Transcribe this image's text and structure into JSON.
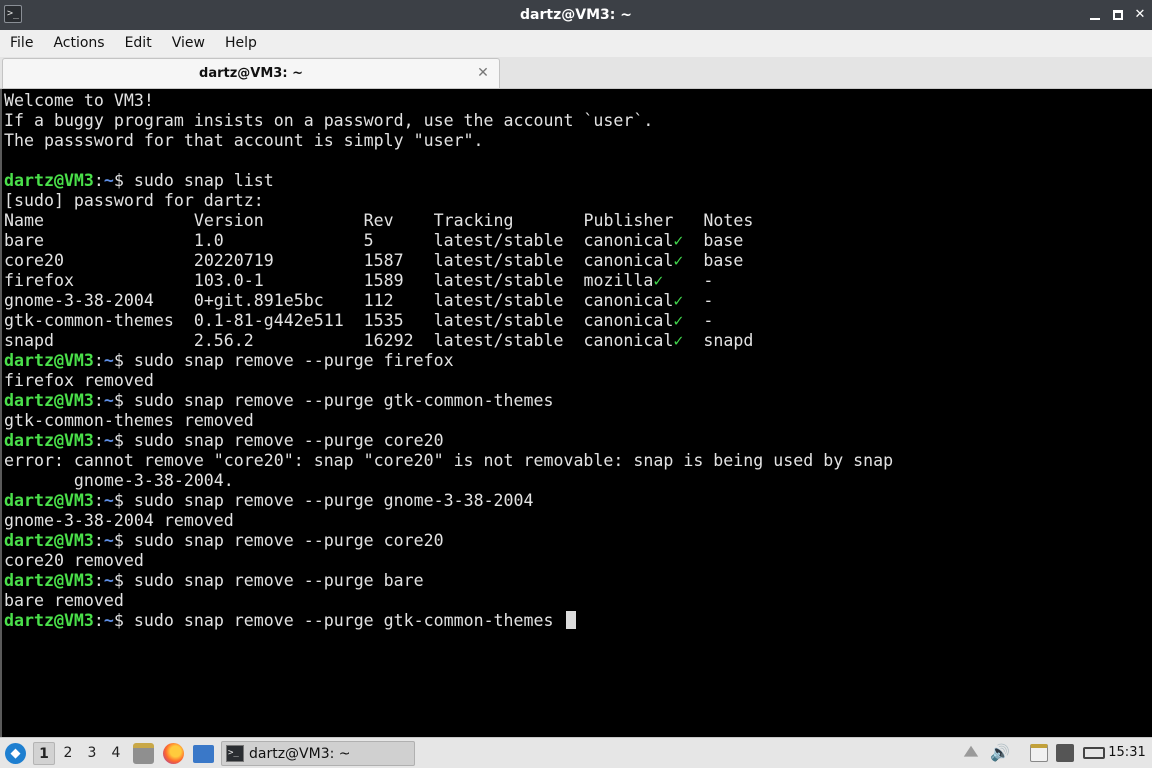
{
  "window": {
    "title": "dartz@VM3: ~",
    "icon_glyph": ">_",
    "close_glyph": "✕"
  },
  "menu": [
    "File",
    "Actions",
    "Edit",
    "View",
    "Help"
  ],
  "tab": {
    "label": "dartz@VM3: ~",
    "close_glyph": "✕"
  },
  "terminal": {
    "prompt_user": "dartz@VM3",
    "prompt_sep": ":",
    "prompt_path": "~",
    "prompt_dollar": "$ ",
    "lines": [
      {
        "kind": "out",
        "text": "Welcome to VM3!"
      },
      {
        "kind": "out",
        "text": "If a buggy program insists on a password, use the account `user`."
      },
      {
        "kind": "out",
        "text": "The passsword for that account is simply \"user\"."
      },
      {
        "kind": "out",
        "text": ""
      },
      {
        "kind": "cmd",
        "text": "sudo snap list"
      },
      {
        "kind": "out",
        "text": "[sudo] password for dartz:"
      },
      {
        "kind": "row",
        "name": "Name",
        "version": "Version",
        "rev": "Rev",
        "tracking": "Tracking",
        "publisher": "Publisher",
        "verified": false,
        "notes": "Notes"
      },
      {
        "kind": "row",
        "name": "bare",
        "version": "1.0",
        "rev": "5",
        "tracking": "latest/stable",
        "publisher": "canonical",
        "verified": true,
        "notes": "base"
      },
      {
        "kind": "row",
        "name": "core20",
        "version": "20220719",
        "rev": "1587",
        "tracking": "latest/stable",
        "publisher": "canonical",
        "verified": true,
        "notes": "base"
      },
      {
        "kind": "row",
        "name": "firefox",
        "version": "103.0-1",
        "rev": "1589",
        "tracking": "latest/stable",
        "publisher": "mozilla",
        "verified": true,
        "notes": "-"
      },
      {
        "kind": "row",
        "name": "gnome-3-38-2004",
        "version": "0+git.891e5bc",
        "rev": "112",
        "tracking": "latest/stable",
        "publisher": "canonical",
        "verified": true,
        "notes": "-"
      },
      {
        "kind": "row",
        "name": "gtk-common-themes",
        "version": "0.1-81-g442e511",
        "rev": "1535",
        "tracking": "latest/stable",
        "publisher": "canonical",
        "verified": true,
        "notes": "-"
      },
      {
        "kind": "row",
        "name": "snapd",
        "version": "2.56.2",
        "rev": "16292",
        "tracking": "latest/stable",
        "publisher": "canonical",
        "verified": true,
        "notes": "snapd"
      },
      {
        "kind": "cmd",
        "text": "sudo snap remove --purge firefox"
      },
      {
        "kind": "out",
        "text": "firefox removed"
      },
      {
        "kind": "cmd",
        "text": "sudo snap remove --purge gtk-common-themes"
      },
      {
        "kind": "out",
        "text": "gtk-common-themes removed"
      },
      {
        "kind": "cmd",
        "text": "sudo snap remove --purge core20"
      },
      {
        "kind": "out",
        "text": "error: cannot remove \"core20\": snap \"core20\" is not removable: snap is being used by snap"
      },
      {
        "kind": "out",
        "text": "       gnome-3-38-2004."
      },
      {
        "kind": "cmd",
        "text": "sudo snap remove --purge gnome-3-38-2004"
      },
      {
        "kind": "out",
        "text": "gnome-3-38-2004 removed"
      },
      {
        "kind": "cmd",
        "text": "sudo snap remove --purge core20"
      },
      {
        "kind": "out",
        "text": "core20 removed"
      },
      {
        "kind": "cmd",
        "text": "sudo snap remove --purge bare"
      },
      {
        "kind": "out",
        "text": "bare removed"
      },
      {
        "kind": "cmd",
        "text": "sudo snap remove --purge gtk-common-themes ",
        "cursor": true
      }
    ],
    "check_glyph": "✓",
    "colors": {
      "prompt_user": "#4ae04a",
      "prompt_path": "#5f8fe6",
      "check": "#3fd24a",
      "text": "#e2e2e2"
    }
  },
  "taskbar": {
    "workspaces": [
      "1",
      "2",
      "3",
      "4"
    ],
    "active_workspace": "1",
    "task_label": "dartz@VM3: ~",
    "volume_glyph": "🔊",
    "clock": "15:31"
  }
}
